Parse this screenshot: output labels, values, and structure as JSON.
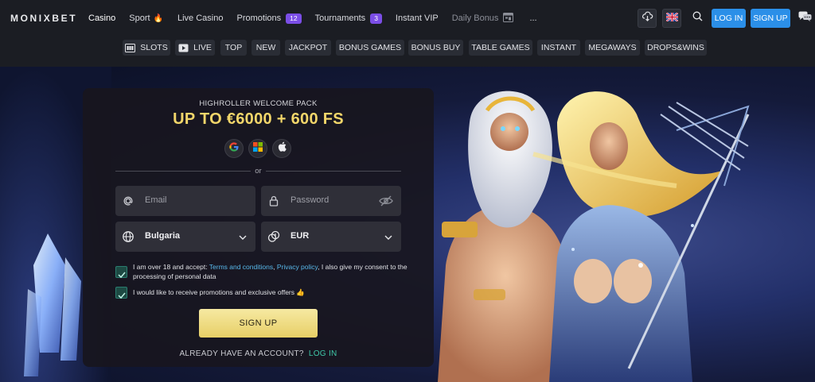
{
  "brand": {
    "logo": "MONIXBET"
  },
  "nav": {
    "items": [
      {
        "label": "Casino",
        "state": "active"
      },
      {
        "label": "Sport",
        "icon": "fire-icon"
      },
      {
        "label": "Live Casino"
      },
      {
        "label": "Promotions",
        "badge": "12"
      },
      {
        "label": "Tournaments",
        "badge": "3"
      },
      {
        "label": "Instant VIP"
      },
      {
        "label": "Daily Bonus",
        "state": "dim",
        "icon": "bonus-calendar-icon"
      },
      {
        "label": "..."
      }
    ]
  },
  "header": {
    "download_icon": "cloud-download-icon",
    "language_icon": "uk-flag-icon",
    "search_icon": "search-icon",
    "login_label": "LOG IN",
    "signup_label": "SIGN UP",
    "chat_icon": "chat-icon"
  },
  "categories": [
    {
      "label": "SLOTS",
      "icon": "slot-machine-icon"
    },
    {
      "label": "LIVE",
      "icon": "live-play-icon"
    },
    {
      "label": "TOP"
    },
    {
      "label": "NEW"
    },
    {
      "label": "JACKPOT"
    },
    {
      "label": "BONUS GAMES"
    },
    {
      "label": "BONUS BUY"
    },
    {
      "label": "TABLE GAMES"
    },
    {
      "label": "INSTANT"
    },
    {
      "label": "MEGAWAYS"
    },
    {
      "label": "DROPS&WINS"
    }
  ],
  "signup_form": {
    "pack_title": "HIGHROLLER WELCOME PACK",
    "offer": "UP TO €6000 + 600 FS",
    "social": [
      "google-icon",
      "microsoft-icon",
      "apple-icon"
    ],
    "or_text": "or",
    "email_placeholder": "Email",
    "password_placeholder": "Password",
    "country_value": "Bulgaria",
    "currency_value": "EUR",
    "consent_prefix": "I am over 18 and accept: ",
    "consent_terms": "Terms and conditions",
    "consent_sep": ", ",
    "consent_privacy": "Privacy policy",
    "consent_suffix": ", I also give my consent to the processing of personal data",
    "promo_consent": "I would like to receive promotions and exclusive offers 👍",
    "submit_label": "SIGN UP",
    "have_account": "ALREADY HAVE AN ACCOUNT?",
    "login_link": "LOG IN"
  },
  "colors": {
    "accent_blue": "#2b8fe8",
    "offer_gold": "#f2d66a",
    "login_green": "#3fc8a8",
    "link_blue": "#58b8ea"
  }
}
